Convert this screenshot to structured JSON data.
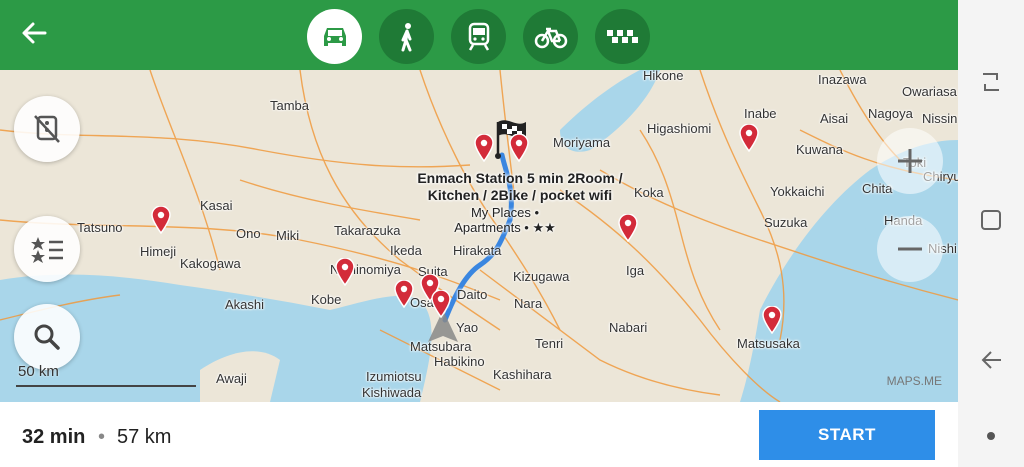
{
  "topbar": {
    "back_icon": "arrow-left-icon",
    "modes": [
      {
        "name": "car",
        "icon": "car-icon",
        "active": true
      },
      {
        "name": "walk",
        "icon": "pedestrian-icon",
        "active": false
      },
      {
        "name": "transit",
        "icon": "train-icon",
        "active": false
      },
      {
        "name": "bicycle",
        "icon": "bicycle-icon",
        "active": false
      },
      {
        "name": "taxi",
        "icon": "taxi-icon",
        "active": false
      }
    ]
  },
  "map": {
    "cities": [
      "Hikone",
      "Inazawa",
      "Owariasa",
      "Tamba",
      "Inabe",
      "Aisai",
      "Nagoya",
      "Nissin",
      "Higashiomi",
      "Moriyama",
      "Kuwana",
      "Toki",
      "Kasai",
      "Koka",
      "Yokkaichi",
      "Chita",
      "Chiryu",
      "Tatsuno",
      "Suzuka",
      "Handa",
      "Ono",
      "Miki",
      "Takarazuka",
      "Himeji",
      "Ikeda",
      "Kakogawa",
      "Hirakata",
      "Nishi",
      "Nishinomiya",
      "Suita",
      "Kizugawa",
      "Iga",
      "Kobe",
      "Akashi",
      "Osaka",
      "Daito",
      "Nara",
      "Yao",
      "Nabari",
      "Tenri",
      "Matsubara",
      "Habikino",
      "Matsusaka",
      "Kashihara",
      "Izumiotsu",
      "Awaji",
      "Kishiwada"
    ],
    "poi_label": "Enmach Station 5 min 2Room / Kitchen / 2Bike / pocket wifi",
    "poi_category": "My Places • Apartments • ★★",
    "scale": "50 km",
    "watermark": "MAPS.ME",
    "colors": {
      "route": "#3a86e0",
      "pin": "#d32b3a",
      "water": "#a9d6ea",
      "road": "#f09a3e",
      "land": "#ece6d8"
    }
  },
  "buttons": {
    "traffic": "traffic-off-icon",
    "bookmarks": "bookmarks-icon",
    "search": "search-icon",
    "zoom_in": "plus-icon",
    "zoom_out": "minus-icon"
  },
  "route": {
    "time": "32 min",
    "separator": "•",
    "distance": "57 km",
    "start_label": "START",
    "accent": "#2e8ee8"
  },
  "navbar": {
    "recent": "recent-apps-icon",
    "home": "home-icon",
    "back": "back-icon",
    "dot": "nav-dot-icon"
  }
}
